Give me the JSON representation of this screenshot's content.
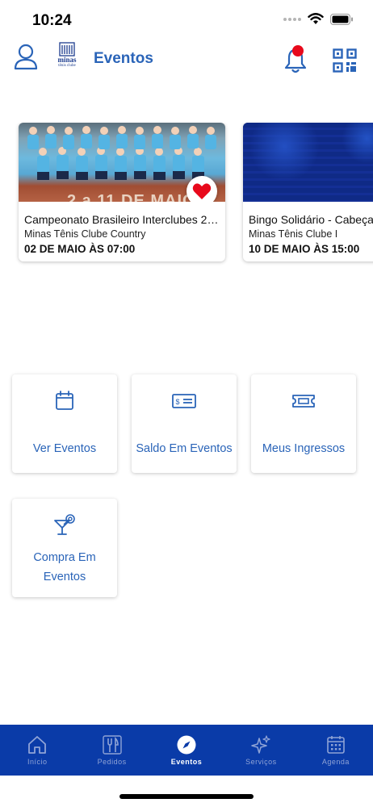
{
  "status_bar": {
    "time": "10:24",
    "icons": [
      "cellular-dots-icon",
      "wifi-icon",
      "battery-icon"
    ]
  },
  "header": {
    "title": "Eventos",
    "logo": {
      "name": "minas",
      "subtitle": "tênis clube"
    },
    "icons": [
      "profile-icon",
      "bell-icon",
      "qr-code-icon"
    ],
    "notification_dot_color": "#e8091b"
  },
  "events": [
    {
      "title": "Campeonato Brasileiro Interclubes 2…",
      "place": "Minas Tênis Clube Country",
      "date": "02 DE MAIO ÀS 07:00",
      "banner_text": "2 a 11 DE MAIO",
      "favorited": true
    },
    {
      "title": "Bingo Solidário - Cabeça d",
      "place": "Minas Tênis Clube I",
      "date": "10 DE MAIO ÀS 15:00",
      "favorited": false
    }
  ],
  "tiles": [
    {
      "label": "Ver Eventos",
      "icon": "calendar-icon"
    },
    {
      "label": "Saldo Em Eventos",
      "icon": "cheque-icon"
    },
    {
      "label": "Meus Ingressos",
      "icon": "ticket-icon"
    },
    {
      "label": "Compra Em Eventos",
      "icon": "cocktail-icon"
    }
  ],
  "tabbar": {
    "active_index": 2,
    "tabs": [
      {
        "label": "Início",
        "icon": "home-icon"
      },
      {
        "label": "Pedidos",
        "icon": "cutlery-icon"
      },
      {
        "label": "Eventos",
        "icon": "compass-icon"
      },
      {
        "label": "Serviços",
        "icon": "sparkles-icon"
      },
      {
        "label": "Agenda",
        "icon": "calendar-grid-icon"
      }
    ]
  },
  "colors": {
    "accent": "#2a64b8",
    "tabbar_bg": "#0a3ba8",
    "favorite": "#e8091b"
  }
}
